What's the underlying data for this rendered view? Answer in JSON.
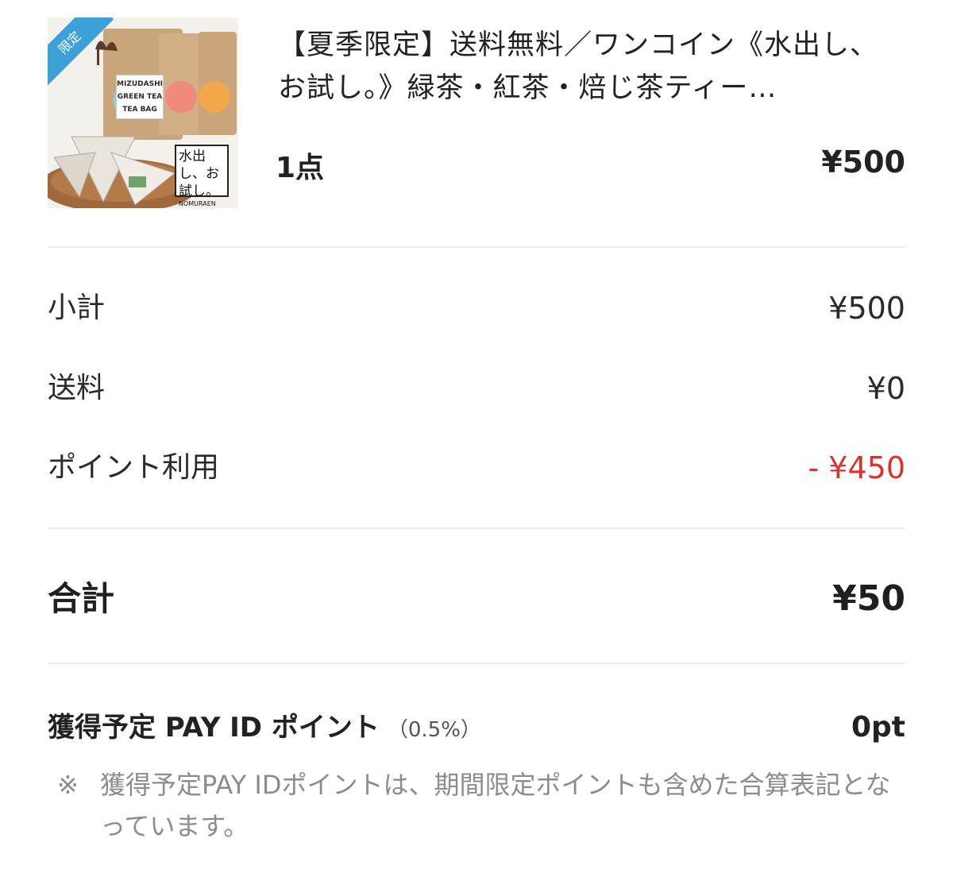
{
  "product": {
    "badge": "限定",
    "image_label": "MIZUDASHI GREEN TEA TEA BAG",
    "image_stamp": "水出し、お試し。",
    "image_brand": "NOMURAEN",
    "title": "【夏季限定】送料無料／ワンコイン《水出し、お試し。》緑茶・紅茶・焙じ茶ティー…",
    "quantity": "1点",
    "price": "¥500"
  },
  "summary": {
    "subtotal_label": "小計",
    "subtotal_value": "¥500",
    "shipping_label": "送料",
    "shipping_value": "¥0",
    "points_used_label": "ポイント利用",
    "points_used_value": "- ¥450",
    "points_used_color": "#d9322f"
  },
  "total": {
    "label": "合計",
    "value": "¥50"
  },
  "earn": {
    "label": "獲得予定 PAY ID ポイント",
    "rate": "（0.5%）",
    "value": "0pt"
  },
  "note": {
    "mark": "※",
    "text": "獲得予定PAY IDポイントは、期間限定ポイントも含めた合算表記となっています。"
  }
}
